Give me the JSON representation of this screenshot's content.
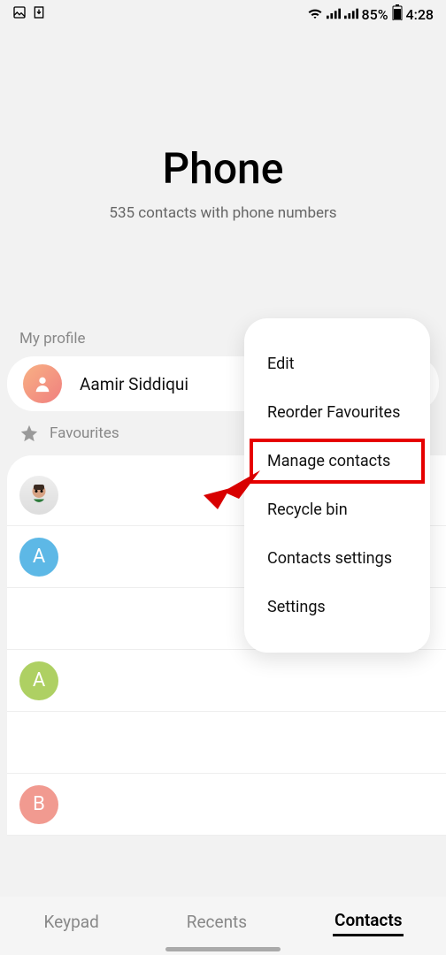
{
  "status": {
    "battery_pct": "85%",
    "time": "4:28"
  },
  "header": {
    "title": "Phone",
    "subtitle": "535 contacts with phone numbers"
  },
  "profile": {
    "section_label": "My profile",
    "name": "Aamir Siddiqui"
  },
  "favourites": {
    "label": "Favourites"
  },
  "contacts": [
    {
      "letter": "",
      "class": "c-emoji"
    },
    {
      "letter": "A",
      "class": "c-blue"
    },
    {
      "letter": "",
      "class": ""
    },
    {
      "letter": "A",
      "class": "c-green"
    },
    {
      "letter": "",
      "class": ""
    },
    {
      "letter": "B",
      "class": "c-coral"
    }
  ],
  "menu": {
    "items": [
      "Edit",
      "Reorder Favourites",
      "Manage contacts",
      "Recycle bin",
      "Contacts settings",
      "Settings"
    ],
    "highlighted_index": 2
  },
  "tabs": {
    "items": [
      "Keypad",
      "Recents",
      "Contacts"
    ],
    "active_index": 2
  }
}
